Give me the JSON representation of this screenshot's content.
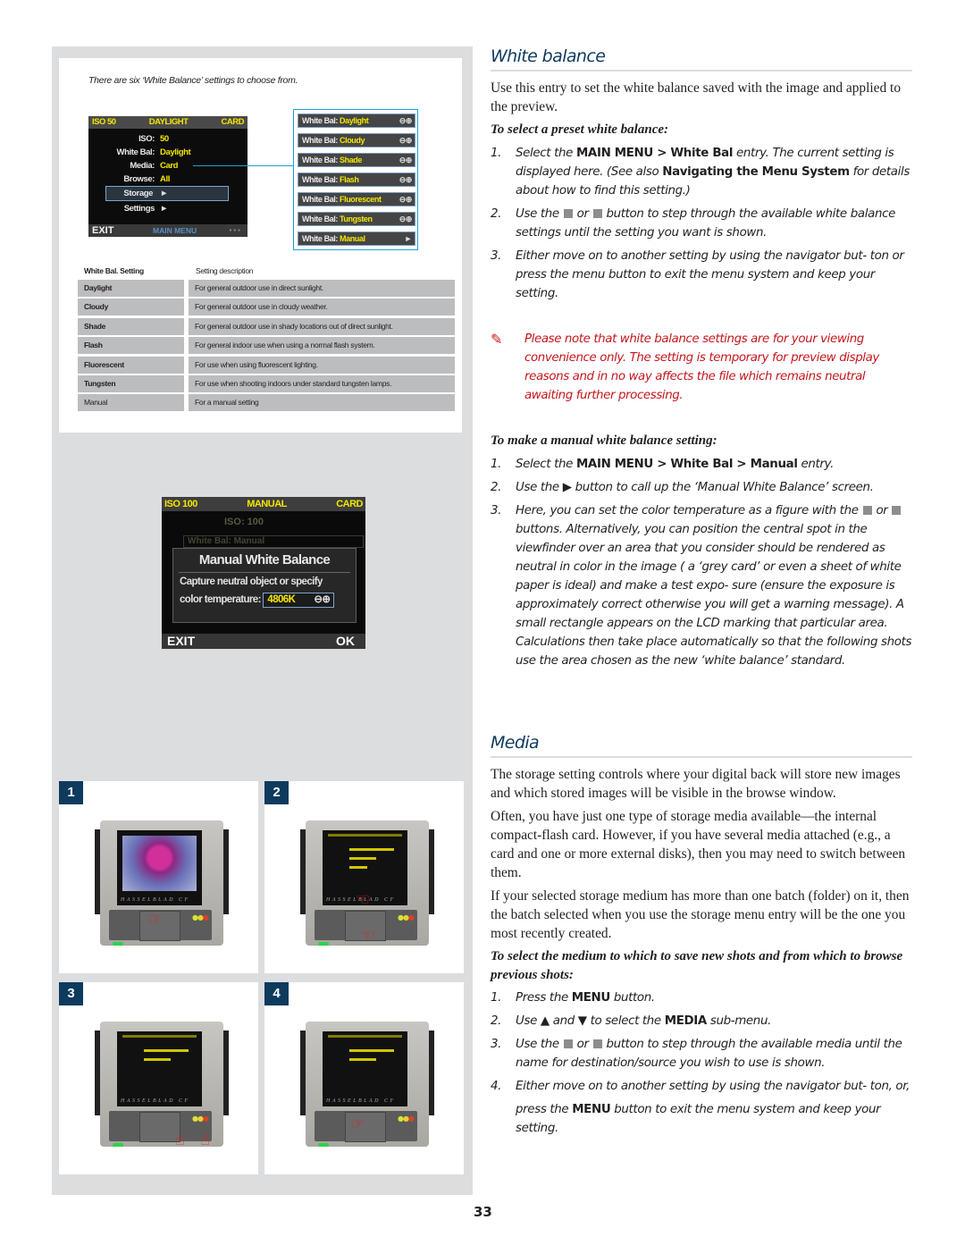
{
  "page_number": "33",
  "figure": {
    "caption": "There are six ‘White Balance’ settings to choose from.",
    "menu_lcd": {
      "top": [
        "ISO 50",
        "DAYLIGHT",
        "CARD"
      ],
      "rows": [
        {
          "key": "ISO:",
          "value": "50"
        },
        {
          "key": "White Bal:",
          "value": "Daylight"
        },
        {
          "key": "Media:",
          "value": "Card"
        },
        {
          "key": "Browse:",
          "value": "All"
        },
        {
          "key": "Storage",
          "value": "►"
        },
        {
          "key": "Settings",
          "value": "►"
        }
      ],
      "exit": "EXIT",
      "main_menu": "MAIN MENU",
      "dots": "▪▪▪"
    },
    "wb_options": [
      {
        "key": "White Bal:",
        "value": "Daylight",
        "control": "⊖⊕"
      },
      {
        "key": "White Bal:",
        "value": "Cloudy",
        "control": "⊖⊕"
      },
      {
        "key": "White Bal:",
        "value": "Shade",
        "control": "⊖⊕"
      },
      {
        "key": "White Bal:",
        "value": "Flash",
        "control": "⊖⊕"
      },
      {
        "key": "White Bal:",
        "value": "Fluorescent",
        "control": "⊖⊕"
      },
      {
        "key": "White Bal:",
        "value": "Tungsten",
        "control": "⊖⊕"
      },
      {
        "key": "White Bal:",
        "value": "Manual",
        "control": "►"
      }
    ],
    "table": {
      "headers": [
        "White Bal. Setting",
        "Setting description"
      ],
      "rows": [
        [
          "Daylight",
          "For general outdoor use in direct sunlight."
        ],
        [
          "Cloudy",
          "For general outdoor use in cloudy weather."
        ],
        [
          "Shade",
          "For general outdoor use in shady locations out of direct sunlight."
        ],
        [
          "Flash",
          "For general indoor use when using a normal flash system."
        ],
        [
          "Fluorescent",
          "For use when using fluorescent lighting."
        ],
        [
          "Tungsten",
          "For use when shooting indoors under standard tungsten lamps."
        ],
        [
          "Manual",
          "For a manual setting"
        ]
      ]
    },
    "manual_screen": {
      "top": [
        "ISO 100",
        "MANUAL",
        "CARD"
      ],
      "ghost_iso": "ISO: 100",
      "ghost_wb": "White Bal: Manual",
      "title": "Manual White Balance",
      "line1": "Capture neutral object or specify",
      "line2_label": "color temperature:",
      "temperature": "4806K",
      "temp_control": "⊖⊕",
      "exit": "EXIT",
      "ok": "OK"
    },
    "steps": [
      {
        "badge": "1",
        "brand": "HASSELBLAD CF"
      },
      {
        "badge": "2",
        "brand": "HASSELBLAD CF"
      },
      {
        "badge": "3",
        "brand": "HASSELBLAD CF"
      },
      {
        "badge": "4",
        "brand": "HASSELBLAD CF"
      }
    ]
  },
  "white_balance": {
    "title": "White balance",
    "intro": "Use this entry to set the white balance saved with the image and applied to the preview.",
    "preset_heading": "To select a preset white balance:",
    "preset_steps": [
      {
        "n": "1.",
        "parts": [
          "Select the ",
          "MAIN MENU > White Bal",
          " entry. The current setting is displayed here. (See also ",
          "Navigating the Menu System",
          " for details about how to find this setting.)"
        ]
      },
      {
        "n": "2.",
        "parts": [
          "Use the ",
          " or ",
          " button to step through the available white balance settings until the setting you want is shown."
        ]
      },
      {
        "n": "3.",
        "text": "Either move on to another setting by using the navigator but- ton or press the menu button to exit the menu system and keep your setting."
      }
    ],
    "note": "Please note that white balance settings are for your viewing convenience only. The setting is temporary for preview display reasons and in no way affects the file which remains neutral awaiting further processing.",
    "manual_heading": "To make a manual white balance setting:",
    "manual_steps": [
      {
        "n": "1.",
        "parts": [
          "Select the ",
          "MAIN MENU > White Bal > Manual",
          " entry."
        ]
      },
      {
        "n": "2.",
        "parts": [
          "Use the ",
          "▶",
          " button to call up the ‘Manual White Balance’ screen."
        ]
      },
      {
        "n": "3.",
        "parts": [
          " or ",
          " buttons. Alternatively, you can position the central spot in the viewfinder over an area that you consider should be rendered as neutral in color in the image ( a ‘grey card’ or even a sheet of white paper is ideal) and make a test expo- sure (ensure the exposure is approximately correct otherwise you will get a warning message). A small rectangle appears on the LCD marking that particular area. Calculations then take place automatically so that the following shots use the area chosen as the new ‘white balance’ standard."
        ],
        "lead": "Here, you can set the color temperature as a figure with the"
      }
    ]
  },
  "media": {
    "title": "Media",
    "paragraphs": [
      "The storage setting controls where your digital back will store new images and which stored images will be visible in the browse window.",
      "Often, you have just one type of storage media available—the internal compact-flash card. However, if you have several media attached (e.g., a card and one or more external disks), then you may need to switch between them.",
      "If your selected storage medium has more than one batch (folder) on it, then the batch selected when you use the storage menu entry will be the one you most recently created."
    ],
    "heading": "To select the medium to which to save new shots and from which to browse previous shots:",
    "steps": [
      {
        "n": "1.",
        "parts": [
          "Press the ",
          "MENU",
          " button."
        ]
      },
      {
        "n": "2.",
        "parts": [
          "Use ",
          "▲",
          " and ",
          "▼",
          " to select the ",
          "MEDIA",
          " sub-menu."
        ]
      },
      {
        "n": "3.",
        "parts": [
          "Use the ",
          " or ",
          " button to step through the available media until the name for destination/source you wish to use is shown."
        ]
      },
      {
        "n": "4.",
        "text": "Either move on to another setting by using the navigator but- ton, or,"
      },
      {
        "n": "",
        "parts": [
          "press the ",
          "MENU",
          " button to exit the menu system and keep your setting."
        ]
      }
    ]
  },
  "colors": {
    "heading_blue": "#0e3a5e",
    "note_red": "#c4161c",
    "panel_grey": "#dcdddf",
    "lcd_yellow": "#f3e600",
    "connector_blue": "#1ea0d8"
  }
}
